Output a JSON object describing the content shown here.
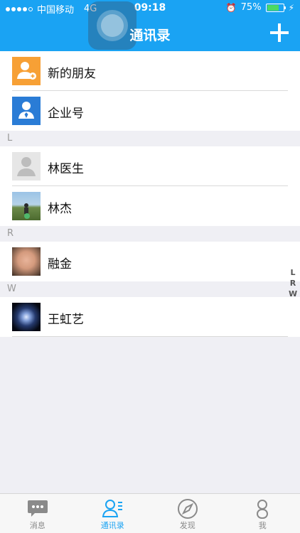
{
  "status": {
    "carrier": "中国移动",
    "network": "4G",
    "time": "09:18",
    "battery": "75%",
    "battery_fill": 0.75
  },
  "nav": {
    "title": "通讯录"
  },
  "top_items": [
    {
      "label": "新的朋友",
      "icon": "new-friend-icon"
    },
    {
      "label": "企业号",
      "icon": "enterprise-icon"
    }
  ],
  "sections": [
    {
      "letter": "L",
      "contacts": [
        {
          "name": "林医生"
        },
        {
          "name": "林杰"
        }
      ]
    },
    {
      "letter": "R",
      "contacts": [
        {
          "name": "融金"
        }
      ]
    },
    {
      "letter": "W",
      "contacts": [
        {
          "name": "王虹艺"
        }
      ]
    }
  ],
  "index_letters": [
    "L",
    "R",
    "W"
  ],
  "tabs": [
    {
      "label": "消息",
      "icon": "chat-bubble-icon"
    },
    {
      "label": "通讯录",
      "icon": "contacts-icon"
    },
    {
      "label": "发现",
      "icon": "compass-icon"
    },
    {
      "label": "我",
      "icon": "person-icon"
    }
  ],
  "colors": {
    "accent": "#1aa3f3",
    "tab_inactive": "#888888"
  }
}
